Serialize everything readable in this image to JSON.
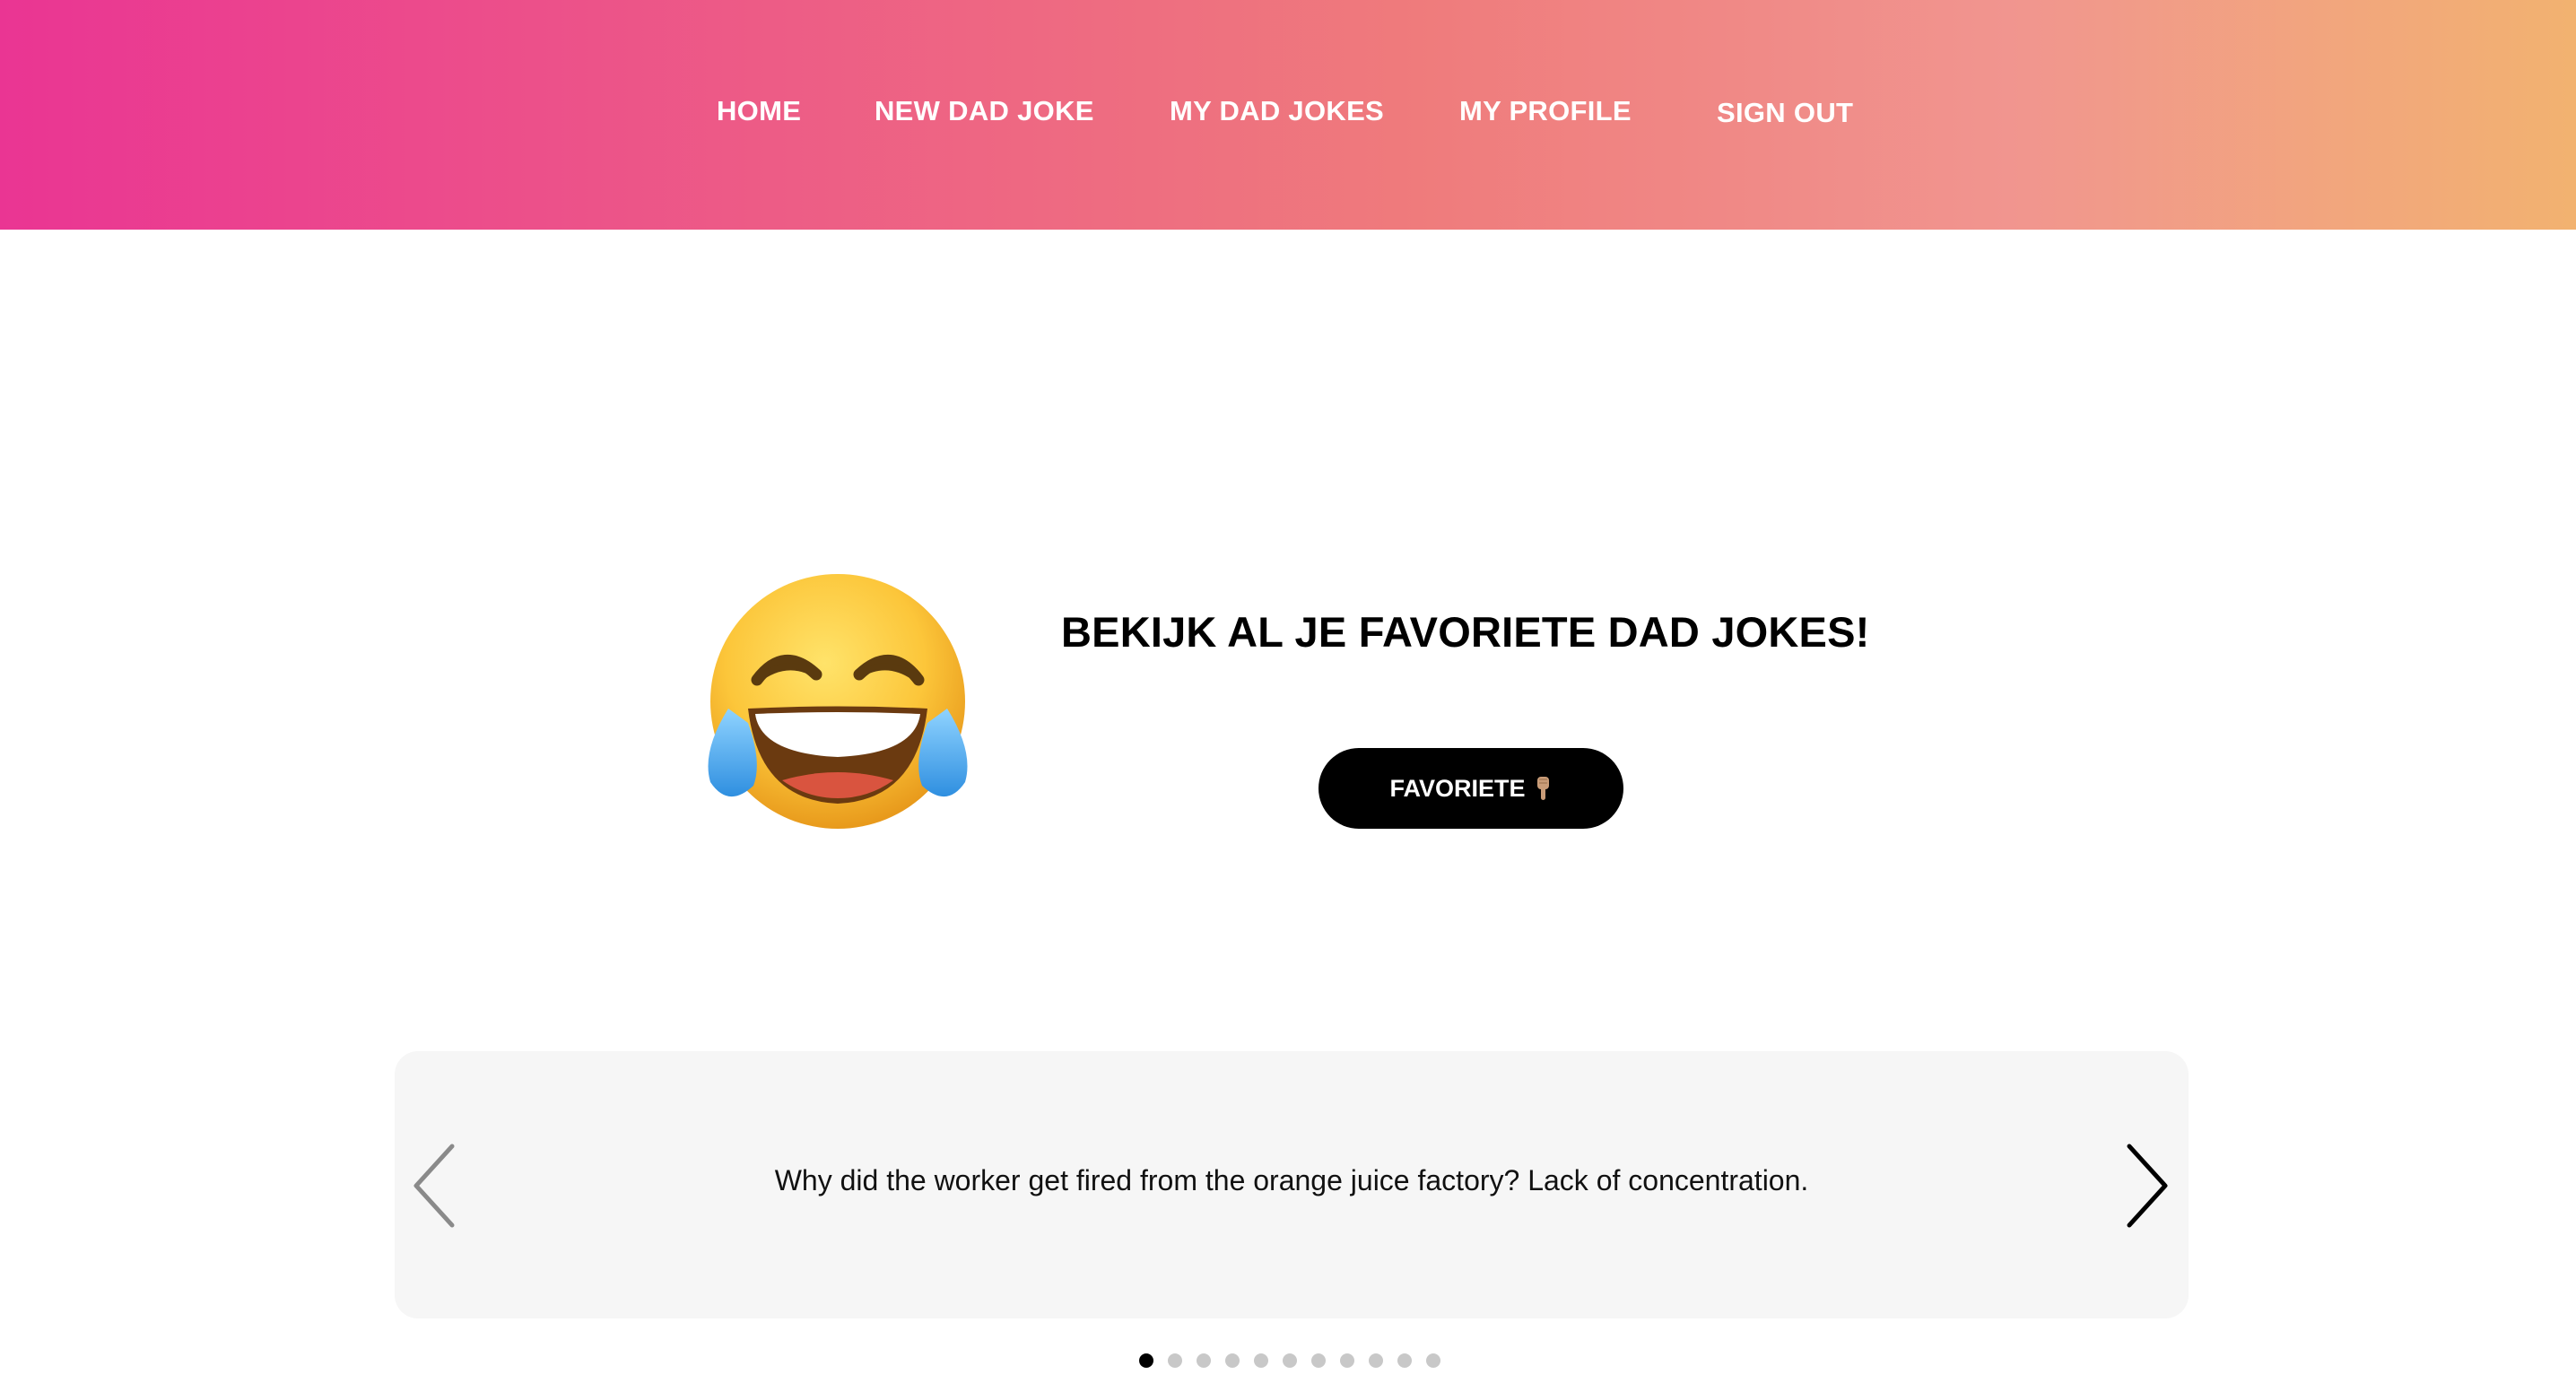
{
  "nav": {
    "home": "HOME",
    "new_joke": "NEW DAD JOKE",
    "my_jokes": "MY DAD JOKES",
    "profile": "MY PROFILE",
    "sign_out": "SIGN OUT"
  },
  "hero": {
    "emoji_icon": "face-with-tears-of-joy-icon",
    "title": "BEKIJK AL JE FAVORIETE DAD JOKES!",
    "button_label": "FAVORIETE",
    "button_icon": "pointing-down-hand-icon"
  },
  "carousel": {
    "joke": "Why did the worker get fired from the orange juice factory? Lack of concentration.",
    "slide_count": 11,
    "active_slide": 1
  },
  "colors": {
    "header_gradient": [
      "#ea3593",
      "#f2b270"
    ],
    "button_bg": "#000000",
    "carousel_bg": "#f6f6f6"
  }
}
